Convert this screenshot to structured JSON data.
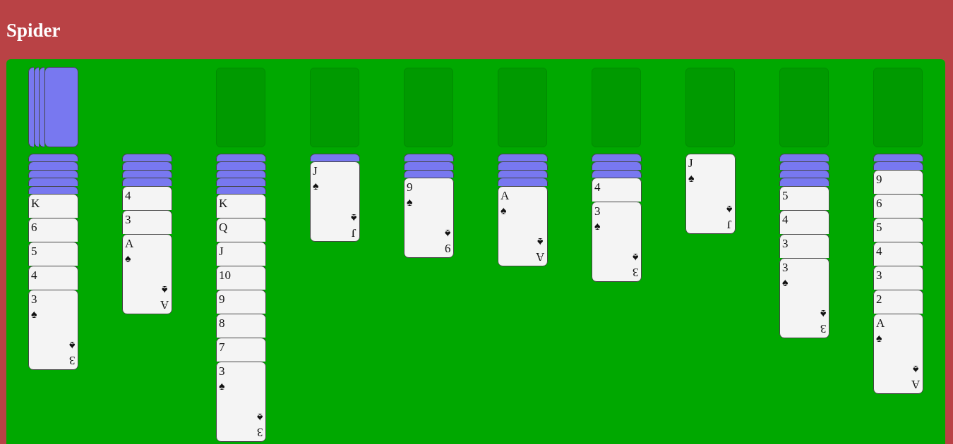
{
  "header": {
    "title": "Spider"
  },
  "stock": {
    "cards": [
      {
        "face_up": false
      },
      {
        "face_up": false
      },
      {
        "face_up": false
      },
      {
        "face_up": false
      }
    ]
  },
  "foundations": [
    {
      "filled": false
    },
    {
      "filled": false
    },
    {
      "filled": false
    },
    {
      "filled": false
    },
    {
      "filled": false
    },
    {
      "filled": false
    },
    {
      "filled": false
    },
    {
      "filled": false
    }
  ],
  "tableau": [
    {
      "cards": [
        {
          "face_up": false
        },
        {
          "face_up": false
        },
        {
          "face_up": false
        },
        {
          "face_up": false
        },
        {
          "face_up": false
        },
        {
          "face_up": true,
          "rank": "K"
        },
        {
          "face_up": true,
          "rank": "6"
        },
        {
          "face_up": true,
          "rank": "5"
        },
        {
          "face_up": true,
          "rank": "4"
        },
        {
          "face_up": true,
          "rank": "3",
          "suit": "♠",
          "corner_rank": "3",
          "corner_suit": "♠"
        }
      ]
    },
    {
      "cards": [
        {
          "face_up": false
        },
        {
          "face_up": false
        },
        {
          "face_up": false
        },
        {
          "face_up": false
        },
        {
          "face_up": true,
          "rank": "4"
        },
        {
          "face_up": true,
          "rank": "3"
        },
        {
          "face_up": true,
          "rank": "A",
          "suit": "♠",
          "corner_rank": "A",
          "corner_suit": "♠"
        }
      ]
    },
    {
      "cards": [
        {
          "face_up": false
        },
        {
          "face_up": false
        },
        {
          "face_up": false
        },
        {
          "face_up": false
        },
        {
          "face_up": false
        },
        {
          "face_up": true,
          "rank": "K"
        },
        {
          "face_up": true,
          "rank": "Q"
        },
        {
          "face_up": true,
          "rank": "J"
        },
        {
          "face_up": true,
          "rank": "10"
        },
        {
          "face_up": true,
          "rank": "9"
        },
        {
          "face_up": true,
          "rank": "8"
        },
        {
          "face_up": true,
          "rank": "7"
        },
        {
          "face_up": true,
          "rank": "3",
          "suit": "♠",
          "corner_rank": "3",
          "corner_suit": "♠"
        }
      ]
    },
    {
      "cards": [
        {
          "face_up": false
        },
        {
          "face_up": true,
          "rank": "J",
          "suit": "♠",
          "corner_rank": "J",
          "corner_suit": "♠"
        }
      ]
    },
    {
      "cards": [
        {
          "face_up": false
        },
        {
          "face_up": false
        },
        {
          "face_up": false
        },
        {
          "face_up": true,
          "rank": "9",
          "suit": "♠",
          "corner_rank": "9",
          "corner_suit": "♠"
        }
      ]
    },
    {
      "cards": [
        {
          "face_up": false
        },
        {
          "face_up": false
        },
        {
          "face_up": false
        },
        {
          "face_up": false
        },
        {
          "face_up": true,
          "rank": "A",
          "suit": "♠",
          "corner_rank": "A",
          "corner_suit": "♠"
        }
      ]
    },
    {
      "cards": [
        {
          "face_up": false
        },
        {
          "face_up": false
        },
        {
          "face_up": false
        },
        {
          "face_up": true,
          "rank": "4"
        },
        {
          "face_up": true,
          "rank": "3",
          "suit": "♠",
          "corner_rank": "3",
          "corner_suit": "♠"
        }
      ]
    },
    {
      "cards": [
        {
          "face_up": true,
          "rank": "J",
          "suit": "♠",
          "corner_rank": "J",
          "corner_suit": "♠"
        }
      ]
    },
    {
      "cards": [
        {
          "face_up": false
        },
        {
          "face_up": false
        },
        {
          "face_up": false
        },
        {
          "face_up": false
        },
        {
          "face_up": true,
          "rank": "5"
        },
        {
          "face_up": true,
          "rank": "4"
        },
        {
          "face_up": true,
          "rank": "3"
        },
        {
          "face_up": true,
          "rank": "3",
          "suit": "♠",
          "corner_rank": "3",
          "corner_suit": "♠"
        }
      ]
    },
    {
      "cards": [
        {
          "face_up": false
        },
        {
          "face_up": false
        },
        {
          "face_up": true,
          "rank": "9"
        },
        {
          "face_up": true,
          "rank": "6"
        },
        {
          "face_up": true,
          "rank": "5"
        },
        {
          "face_up": true,
          "rank": "4"
        },
        {
          "face_up": true,
          "rank": "3"
        },
        {
          "face_up": true,
          "rank": "2"
        },
        {
          "face_up": true,
          "rank": "A",
          "suit": "♠",
          "corner_rank": "A",
          "corner_suit": "♠"
        }
      ]
    }
  ]
}
